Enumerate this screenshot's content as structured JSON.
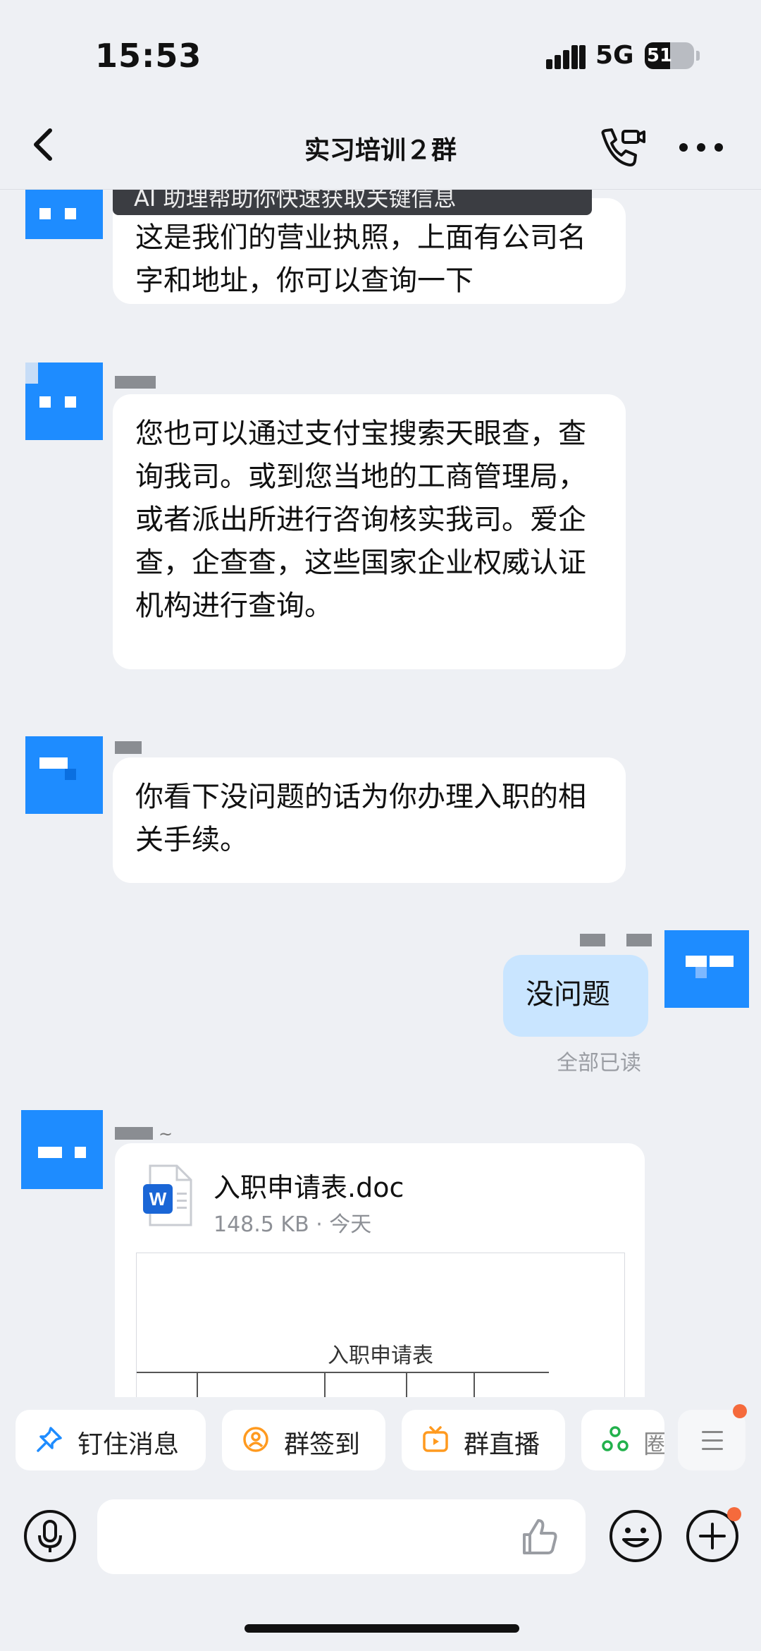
{
  "status_bar": {
    "time": "15:53",
    "network": "5G",
    "battery_level": "51",
    "battery_fraction": 0.51
  },
  "nav": {
    "title": "实习培训２群",
    "back_icon": "chevron-left-icon",
    "call_icon": "video-call-icon",
    "more_icon": "more-dots-icon"
  },
  "messages": [
    {
      "side": "left",
      "tooltip": "AI 助理帮助你快速获取关键信息",
      "text": "这是我们的营业执照，上面有公司名字和地址，你可以查询一下"
    },
    {
      "side": "left",
      "text": "您也可以通过支付宝搜索天眼查，查询我司。或到您当地的工商管理局，或者派出所进行咨询核实我司。爱企查，企查查，这些国家企业权威认证机构进行查询。"
    },
    {
      "side": "left",
      "text": "你看下没问题的话为你办理入职的相关手续。"
    },
    {
      "side": "right",
      "text": "没问题",
      "read_status": "全部已读"
    }
  ],
  "file_message": {
    "tilde": "~",
    "file_name": "入职申请表.doc",
    "meta": "148.5 KB · 今天",
    "preview_title": "入职申请表",
    "file_icon": "word-doc-icon"
  },
  "quick_actions": [
    {
      "label": "钉住消息",
      "icon": "pin-icon",
      "color": "#1e8cff"
    },
    {
      "label": "群签到",
      "icon": "location-icon",
      "color": "#ff9a1f"
    },
    {
      "label": "群直播",
      "icon": "live-tv-icon",
      "color": "#ff9a1f"
    },
    {
      "label": "圈",
      "icon": "circle-group-icon",
      "color": "#22b14c"
    }
  ],
  "input": {
    "placeholder": "",
    "mic_icon": "microphone-icon",
    "like_icon": "thumbs-up-icon",
    "emoji_icon": "emoji-icon",
    "plus_icon": "plus-icon"
  },
  "colors": {
    "background": "#eef0f4",
    "bubble": "#ffffff",
    "self_bubble": "#c9e5ff",
    "avatar_blue": "#1e8cff",
    "notification": "#f56a3c"
  }
}
